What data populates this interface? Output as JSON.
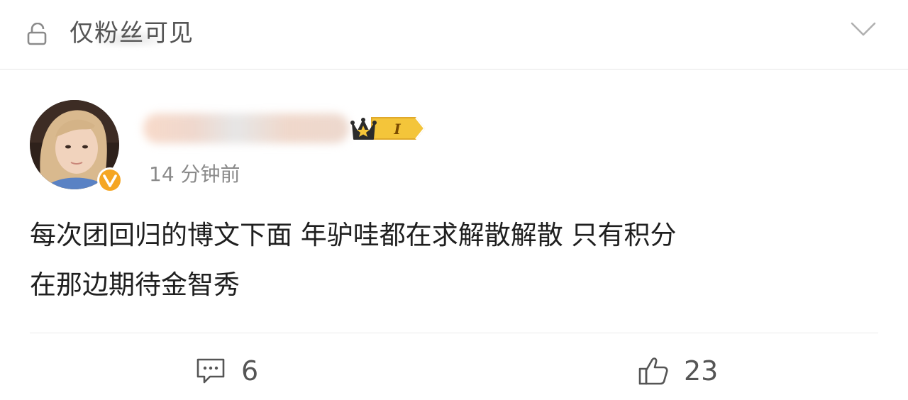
{
  "header": {
    "visibility_label": "仅粉丝可见",
    "lock_icon": "lock-icon",
    "expand_icon": "chevron-down-icon"
  },
  "comment": {
    "timestamp": "14 分钟前",
    "rank_badge_text": "I",
    "rank_badge_icon": "crown-icon",
    "verified_icon": "verified-v-icon",
    "lines": [
      "每次团回归的博文下面 年驴哇都在求解散解散 只有积分",
      "在那边期待金智秀"
    ]
  },
  "actions": {
    "comment_count": "6",
    "like_count": "23",
    "comment_icon": "comment-bubble-icon",
    "like_icon": "thumbs-up-icon"
  },
  "colors": {
    "badge_gold": "#f4c53a",
    "verified_orange": "#f5a623",
    "text_primary": "#1f1f1f",
    "text_secondary": "#8a8a8a"
  }
}
